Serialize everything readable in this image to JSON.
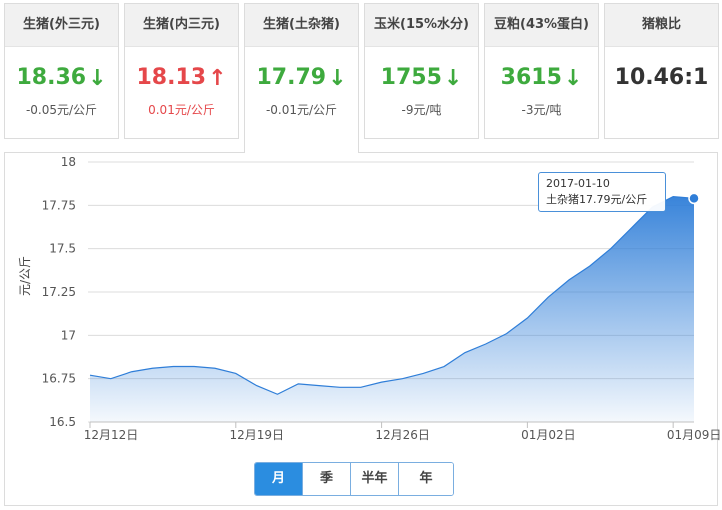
{
  "cards": [
    {
      "title": "生猪(外三元)",
      "value": "18.36",
      "arrow": "↓",
      "trend": "down",
      "change": "-0.05元/公斤"
    },
    {
      "title": "生猪(内三元)",
      "value": "18.13",
      "arrow": "↑",
      "trend": "up",
      "change": "0.01元/公斤"
    },
    {
      "title": "生猪(土杂猪)",
      "value": "17.79",
      "arrow": "↓",
      "trend": "down",
      "change": "-0.01元/公斤"
    },
    {
      "title": "玉米(15%水分)",
      "value": "1755",
      "arrow": "↓",
      "trend": "down",
      "change": "-9元/吨"
    },
    {
      "title": "豆粕(43%蛋白)",
      "value": "3615",
      "arrow": "↓",
      "trend": "down",
      "change": "-3元/吨"
    },
    {
      "title": "猪粮比",
      "value": "10.46:1",
      "arrow": "",
      "trend": "neutral",
      "change": ""
    }
  ],
  "active_card": "生猪(土杂猪)",
  "chart_data": {
    "type": "area",
    "ylabel": "元/公斤",
    "ylim": [
      16.5,
      18
    ],
    "yticks": [
      "18",
      "17.75",
      "17.5",
      "17.25",
      "17",
      "16.75",
      "16.5"
    ],
    "xticks": [
      "12月12日",
      "12月19日",
      "12月26日",
      "01月02日",
      "01月09日"
    ],
    "grid": true,
    "series": [
      {
        "name": "土杂猪",
        "color": "#2f7ed8",
        "x": [
          "2016-12-12",
          "2016-12-13",
          "2016-12-14",
          "2016-12-15",
          "2016-12-16",
          "2016-12-17",
          "2016-12-18",
          "2016-12-19",
          "2016-12-20",
          "2016-12-21",
          "2016-12-22",
          "2016-12-23",
          "2016-12-24",
          "2016-12-25",
          "2016-12-26",
          "2016-12-27",
          "2016-12-28",
          "2016-12-29",
          "2016-12-30",
          "2016-12-31",
          "2017-01-01",
          "2017-01-02",
          "2017-01-03",
          "2017-01-04",
          "2017-01-05",
          "2017-01-06",
          "2017-01-07",
          "2017-01-08",
          "2017-01-09",
          "2017-01-10"
        ],
        "values": [
          16.77,
          16.75,
          16.79,
          16.81,
          16.82,
          16.82,
          16.81,
          16.78,
          16.71,
          16.66,
          16.72,
          16.71,
          16.7,
          16.7,
          16.73,
          16.75,
          16.78,
          16.82,
          16.9,
          16.95,
          17.01,
          17.1,
          17.22,
          17.32,
          17.4,
          17.5,
          17.62,
          17.74,
          17.8,
          17.79
        ]
      }
    ]
  },
  "tooltip": {
    "date": "2017-01-10",
    "text": "土杂猪17.79元/公斤"
  },
  "periods": [
    {
      "label": "月",
      "selected": true
    },
    {
      "label": "季",
      "selected": false
    },
    {
      "label": "半年",
      "selected": false
    },
    {
      "label": "年",
      "selected": false
    }
  ]
}
